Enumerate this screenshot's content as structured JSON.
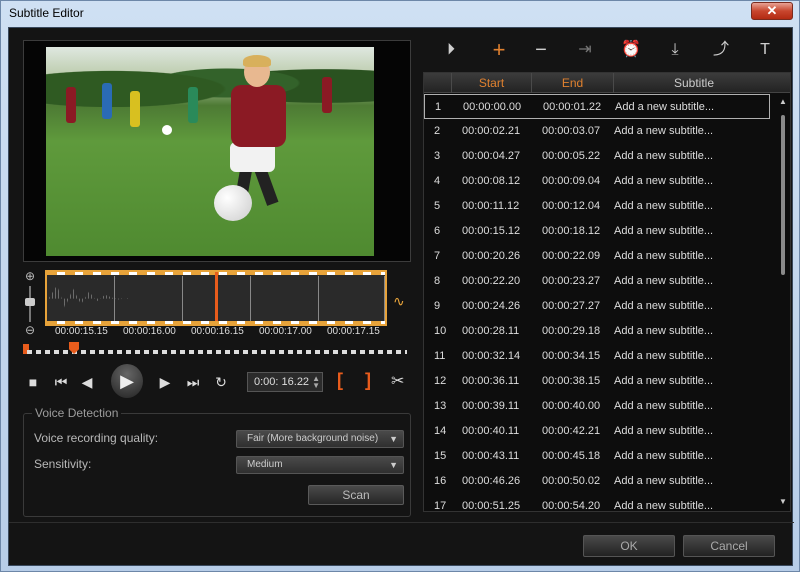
{
  "window": {
    "title": "Subtitle Editor",
    "close": "✕"
  },
  "waveform": {
    "times": [
      "00:00:15.15",
      "00:00:16.00",
      "00:00:16.15",
      "00:00:17.00",
      "00:00:17.15"
    ]
  },
  "transport": {
    "timecode": "0:00: 16.22"
  },
  "voice_detection": {
    "legend": "Voice Detection",
    "quality_label": "Voice recording quality:",
    "quality_value": "Fair (More background noise)",
    "sensitivity_label": "Sensitivity:",
    "sensitivity_value": "Medium",
    "scan_label": "Scan"
  },
  "table": {
    "headers": {
      "start": "Start",
      "end": "End",
      "subtitle": "Subtitle"
    },
    "rows": [
      {
        "n": "1",
        "start": "00:00:00.00",
        "end": "00:00:01.22",
        "text": "Add a new subtitle..."
      },
      {
        "n": "2",
        "start": "00:00:02.21",
        "end": "00:00:03.07",
        "text": "Add a new subtitle..."
      },
      {
        "n": "3",
        "start": "00:00:04.27",
        "end": "00:00:05.22",
        "text": "Add a new subtitle..."
      },
      {
        "n": "4",
        "start": "00:00:08.12",
        "end": "00:00:09.04",
        "text": "Add a new subtitle..."
      },
      {
        "n": "5",
        "start": "00:00:11.12",
        "end": "00:00:12.04",
        "text": "Add a new subtitle..."
      },
      {
        "n": "6",
        "start": "00:00:15.12",
        "end": "00:00:18.12",
        "text": "Add a new subtitle..."
      },
      {
        "n": "7",
        "start": "00:00:20.26",
        "end": "00:00:22.09",
        "text": "Add a new subtitle..."
      },
      {
        "n": "8",
        "start": "00:00:22.20",
        "end": "00:00:23.27",
        "text": "Add a new subtitle..."
      },
      {
        "n": "9",
        "start": "00:00:24.26",
        "end": "00:00:27.27",
        "text": "Add a new subtitle..."
      },
      {
        "n": "10",
        "start": "00:00:28.11",
        "end": "00:00:29.18",
        "text": "Add a new subtitle..."
      },
      {
        "n": "11",
        "start": "00:00:32.14",
        "end": "00:00:34.15",
        "text": "Add a new subtitle..."
      },
      {
        "n": "12",
        "start": "00:00:36.11",
        "end": "00:00:38.15",
        "text": "Add a new subtitle..."
      },
      {
        "n": "13",
        "start": "00:00:39.11",
        "end": "00:00:40.00",
        "text": "Add a new subtitle..."
      },
      {
        "n": "14",
        "start": "00:00:40.11",
        "end": "00:00:42.21",
        "text": "Add a new subtitle..."
      },
      {
        "n": "15",
        "start": "00:00:43.11",
        "end": "00:00:45.18",
        "text": "Add a new subtitle..."
      },
      {
        "n": "16",
        "start": "00:00:46.26",
        "end": "00:00:50.02",
        "text": "Add a new subtitle..."
      },
      {
        "n": "17",
        "start": "00:00:51.25",
        "end": "00:00:54.20",
        "text": "Add a new subtitle..."
      }
    ]
  },
  "buttons": {
    "ok": "OK",
    "cancel": "Cancel"
  },
  "colors": {
    "accent": "#e7a33a",
    "playhead": "#e85c1c",
    "header_text": "#e0812f"
  }
}
